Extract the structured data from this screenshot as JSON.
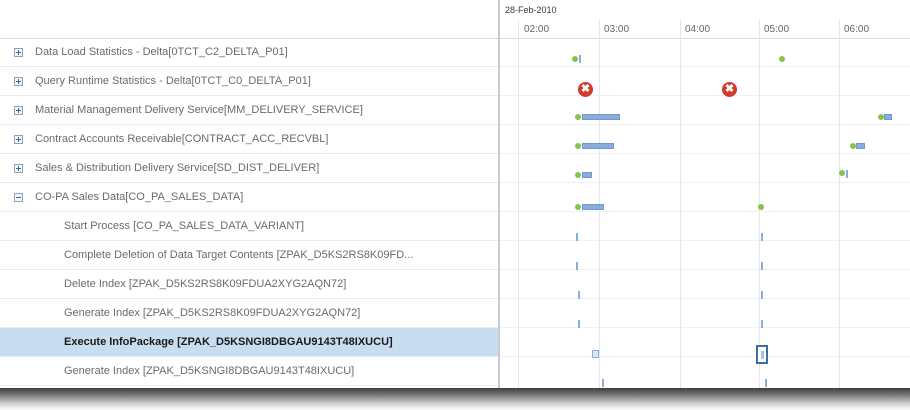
{
  "timeline": {
    "date": "28-Feb-2010",
    "ticks": [
      "02:00",
      "03:00",
      "04:00",
      "05:00",
      "06:00"
    ]
  },
  "rows": [
    {
      "label": "Data Load Statistics - Delta[0TCT_C2_DELTA_P01]",
      "expander": "plus",
      "child": false
    },
    {
      "label": "Query Runtime Statistics - Delta[0TCT_C0_DELTA_P01]",
      "expander": "plus",
      "child": false
    },
    {
      "label": "Material Management Delivery Service[MM_DELIVERY_SERVICE]",
      "expander": "plus",
      "child": false
    },
    {
      "label": "Contract Accounts Receivable[CONTRACT_ACC_RECVBL]",
      "expander": "plus",
      "child": false
    },
    {
      "label": "Sales & Distribution Delivery Service[SD_DIST_DELIVER]",
      "expander": "plus",
      "child": false
    },
    {
      "label": "CO-PA Sales Data[CO_PA_SALES_DATA]",
      "expander": "minus",
      "child": false
    },
    {
      "label": "Start Process [CO_PA_SALES_DATA_VARIANT]",
      "child": true
    },
    {
      "label": "Complete Deletion of Data Target Contents [ZPAK_D5KS2RS8K09FD...",
      "child": true
    },
    {
      "label": "Delete Index [ZPAK_D5KS2RS8K09FDUA2XYG2AQN72]",
      "child": true
    },
    {
      "label": "Generate Index [ZPAK_D5KS2RS8K09FDUA2XYG2AQN72]",
      "child": true
    },
    {
      "label": "Execute InfoPackage [ZPAK_D5KSNGI8DBGAU9143T48IXUCU]",
      "child": true,
      "selected": true
    },
    {
      "label": "Generate Index [ZPAK_D5KSNGI8DBGAU9143T48IXUCU]",
      "child": true
    }
  ],
  "icons": {
    "expand": "plus-square-icon",
    "collapse": "minus-square-icon",
    "error": "error-x-icon",
    "run_start": "green-dot-icon"
  },
  "colors": {
    "selection": "#c9ddf1",
    "run_bar": "#8aaedb",
    "run_start": "#89c24b",
    "error": "#d23a2d"
  }
}
